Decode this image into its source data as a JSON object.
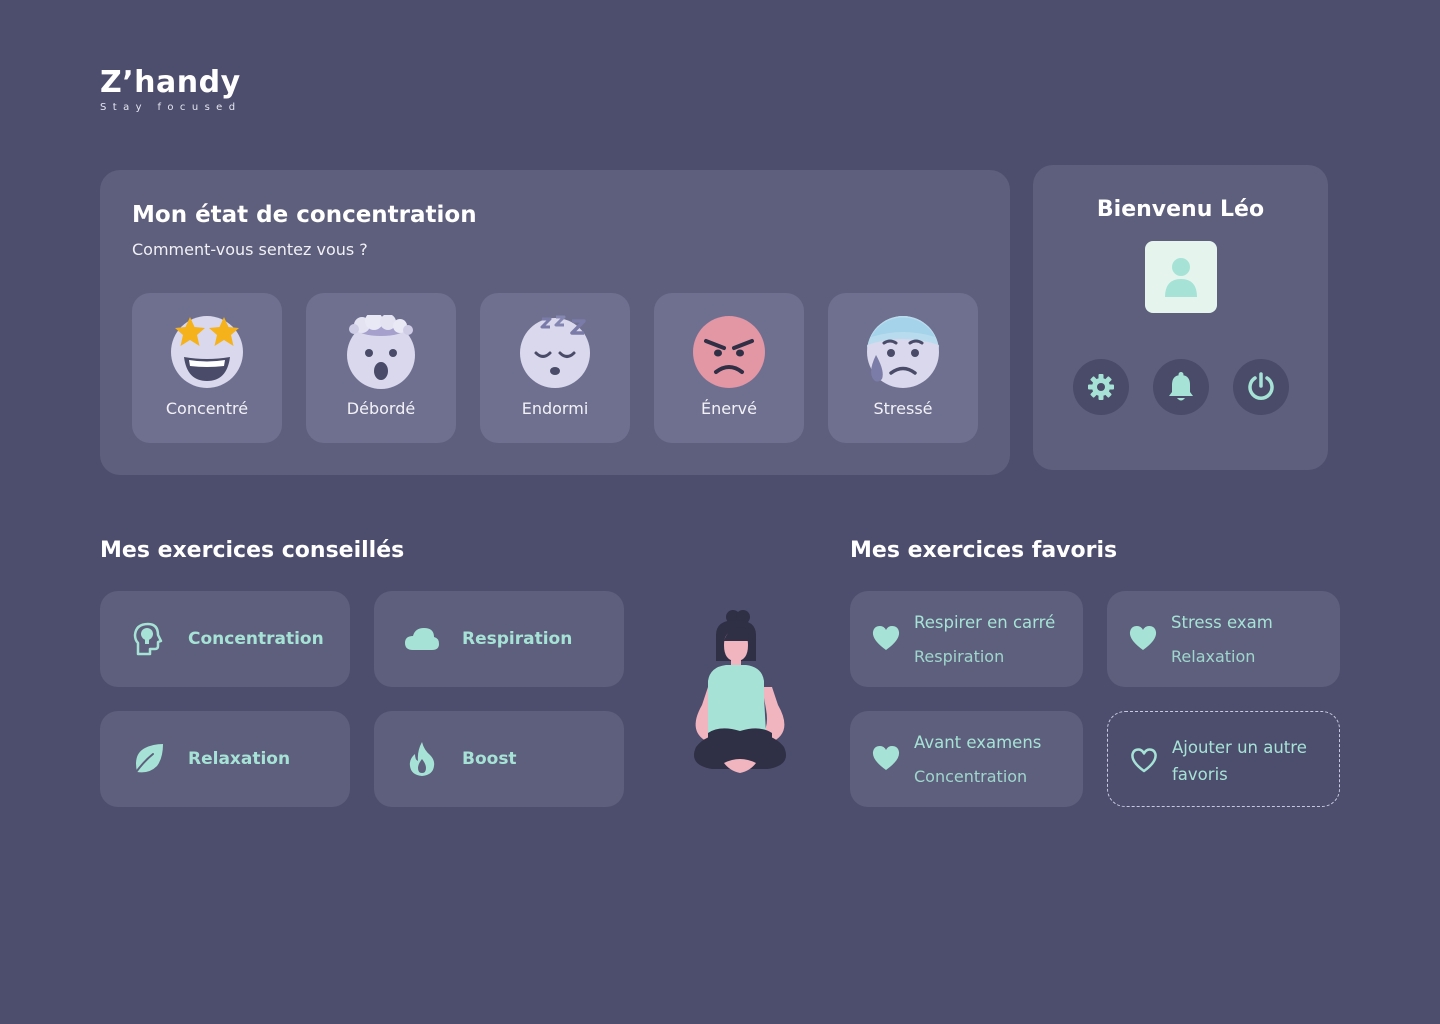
{
  "brand": {
    "name": "Z’handy",
    "tagline": "Stay focused"
  },
  "mood": {
    "title": "Mon état de concentration",
    "subtitle": "Comment-vous sentez vous ?",
    "options": [
      {
        "label": "Concentré",
        "icon": "star-struck-face-icon"
      },
      {
        "label": "Débordé",
        "icon": "exploding-head-icon"
      },
      {
        "label": "Endormi",
        "icon": "sleeping-face-icon"
      },
      {
        "label": "Énervé",
        "icon": "angry-face-icon"
      },
      {
        "label": "Stressé",
        "icon": "anxious-sweat-face-icon"
      }
    ]
  },
  "welcome": {
    "title": "Bienvenu Léo",
    "actions": [
      "settings-icon",
      "bell-icon",
      "power-icon"
    ]
  },
  "recommended": {
    "title": "Mes exercices conseillés",
    "items": [
      {
        "label": "Concentration",
        "icon": "head-brain-icon"
      },
      {
        "label": "Respiration",
        "icon": "cloud-icon"
      },
      {
        "label": "Relaxation",
        "icon": "leaf-icon"
      },
      {
        "label": "Boost",
        "icon": "flame-icon"
      }
    ]
  },
  "favorites": {
    "title": "Mes exercices favoris",
    "items": [
      {
        "name": "Respirer en carré",
        "category": "Respiration"
      },
      {
        "name": "Stress exam",
        "category": "Relaxation"
      },
      {
        "name": "Avant examens",
        "category": "Concentration"
      }
    ],
    "add_label": "Ajouter un autre favoris"
  },
  "colors": {
    "background": "#4d4e6d",
    "panel": "#5e5f7c",
    "card": "#6f7090",
    "accent": "#a6e3d6"
  }
}
